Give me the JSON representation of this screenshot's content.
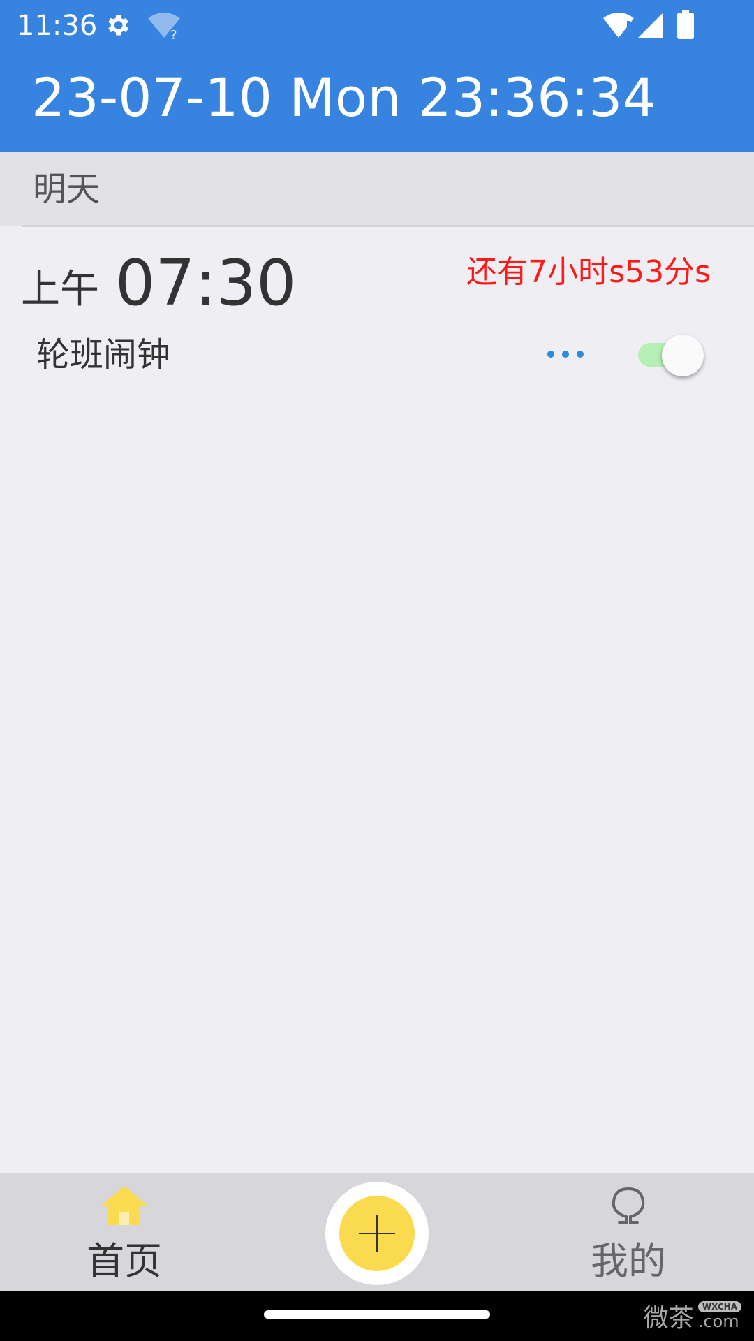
{
  "status_bar": {
    "time": "11:36",
    "icons": [
      "settings-gear-icon",
      "wifi-question-icon",
      "wifi-alert-icon",
      "cell-signal-icon",
      "battery-icon"
    ]
  },
  "header": {
    "clock": "23-07-10 Mon 23:36:34"
  },
  "section": {
    "title": "明天"
  },
  "alarm": {
    "period": "上午",
    "time": "07:30",
    "remaining": "还有7小时s53分s",
    "label": "轮班闹钟",
    "enabled": true
  },
  "bottom_nav": {
    "home_label": "首页",
    "mine_label": "我的",
    "add_icon": "plus-icon"
  },
  "watermark": {
    "text": "微茶",
    "badge": "WXCHA",
    "suffix": ".com"
  },
  "colors": {
    "header": "#3784e0",
    "remaining": "#ff1a1a",
    "fab": "#fadb4f",
    "home_icon": "#fadb4f",
    "toggle_track": "#b4efb4",
    "more_dots": "#2b8de0"
  }
}
